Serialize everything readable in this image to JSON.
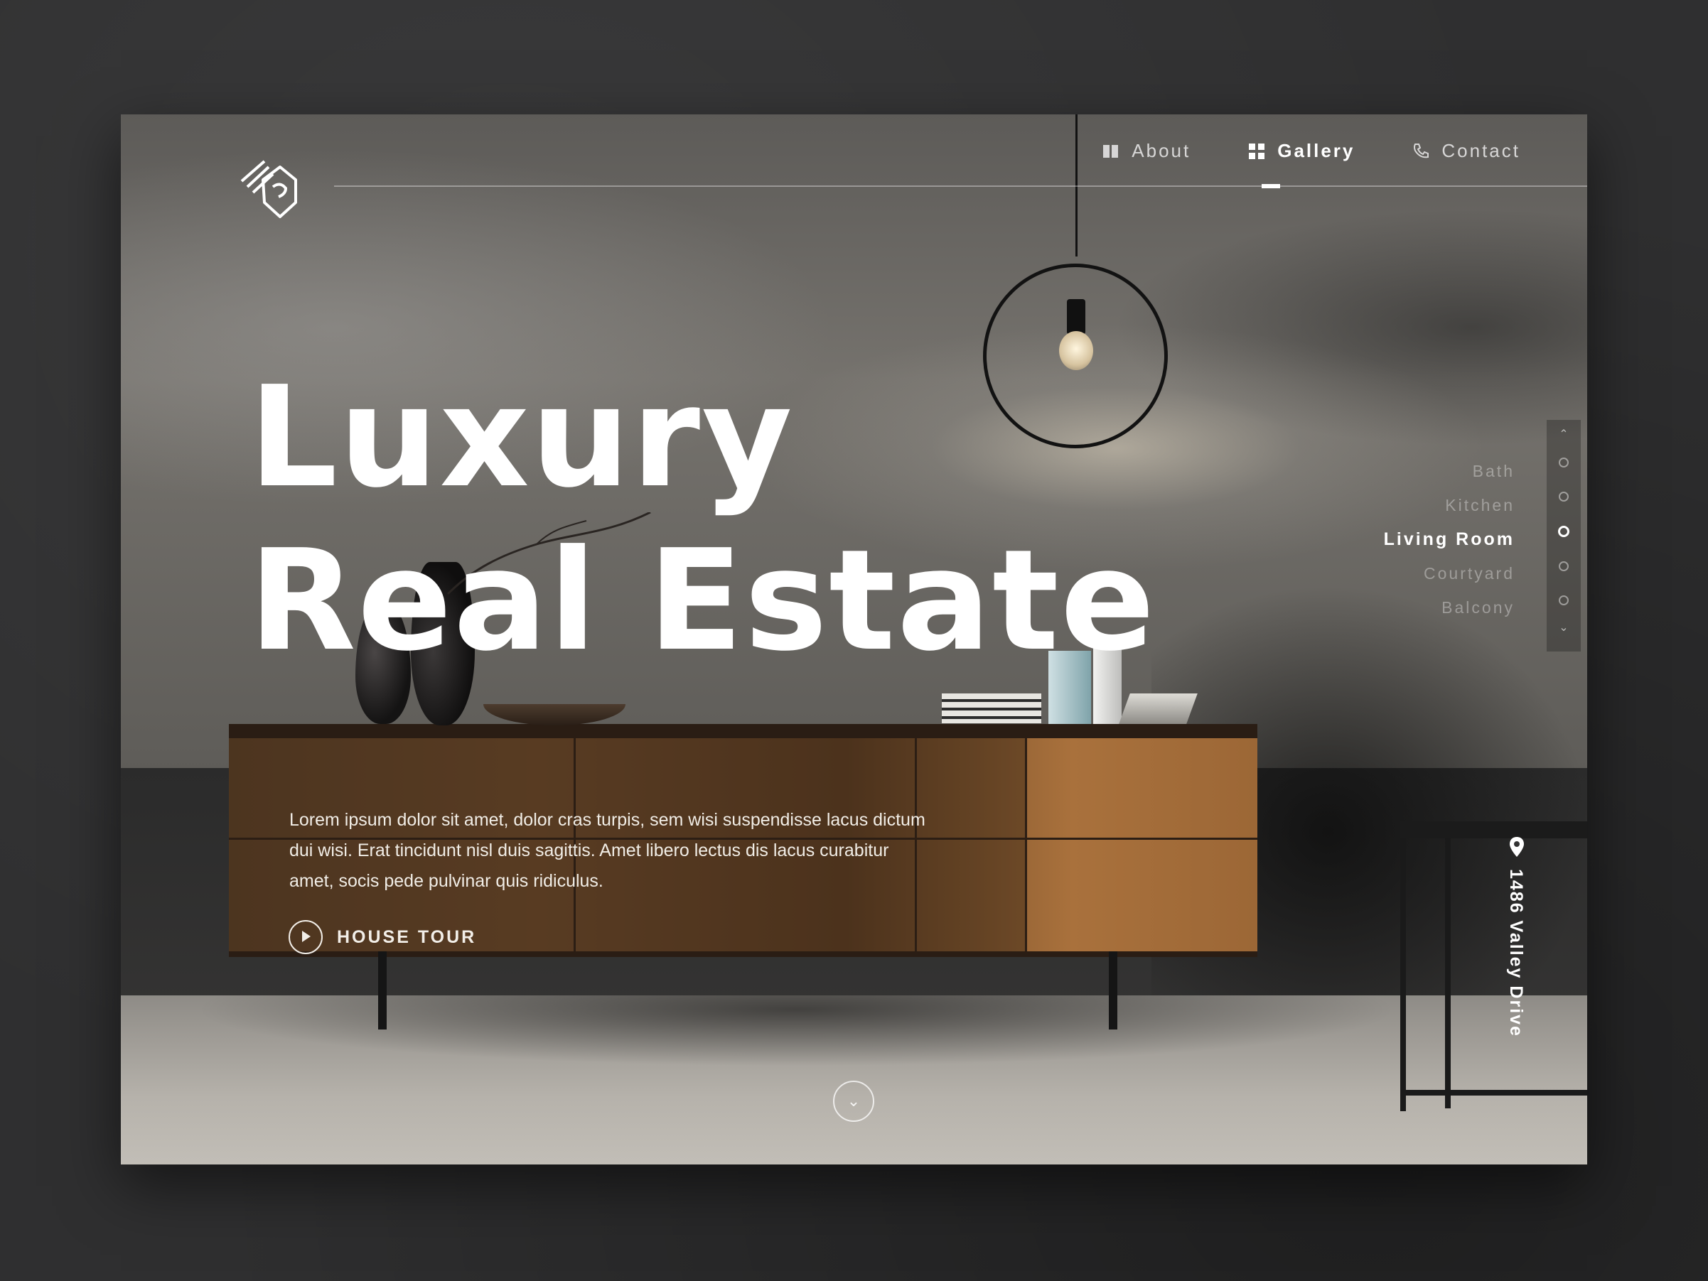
{
  "nav": {
    "items": [
      {
        "label": "About",
        "icon": "about-grid-icon",
        "active": false
      },
      {
        "label": "Gallery",
        "icon": "gallery-grid-icon",
        "active": true
      },
      {
        "label": "Contact",
        "icon": "phone-icon",
        "active": false
      }
    ]
  },
  "hero": {
    "title": "Luxury\nReal Estate",
    "description": "Lorem ipsum dolor sit amet, dolor cras turpis, sem wisi suspendisse lacus dictum dui wisi. Erat tincidunt nisl duis sagittis. Amet libero lectus dis lacus curabitur amet, socis pede pulvinar quis ridiculus.",
    "tour_label": "HOUSE TOUR"
  },
  "rooms": {
    "items": [
      "Bath",
      "Kitchen",
      "Living Room",
      "Courtyard",
      "Balcony"
    ],
    "active_index": 2
  },
  "address": "1486 Valley Drive",
  "colors": {
    "background": "#2f2f30",
    "text": "#ffffff",
    "wood": "#7d5431"
  }
}
